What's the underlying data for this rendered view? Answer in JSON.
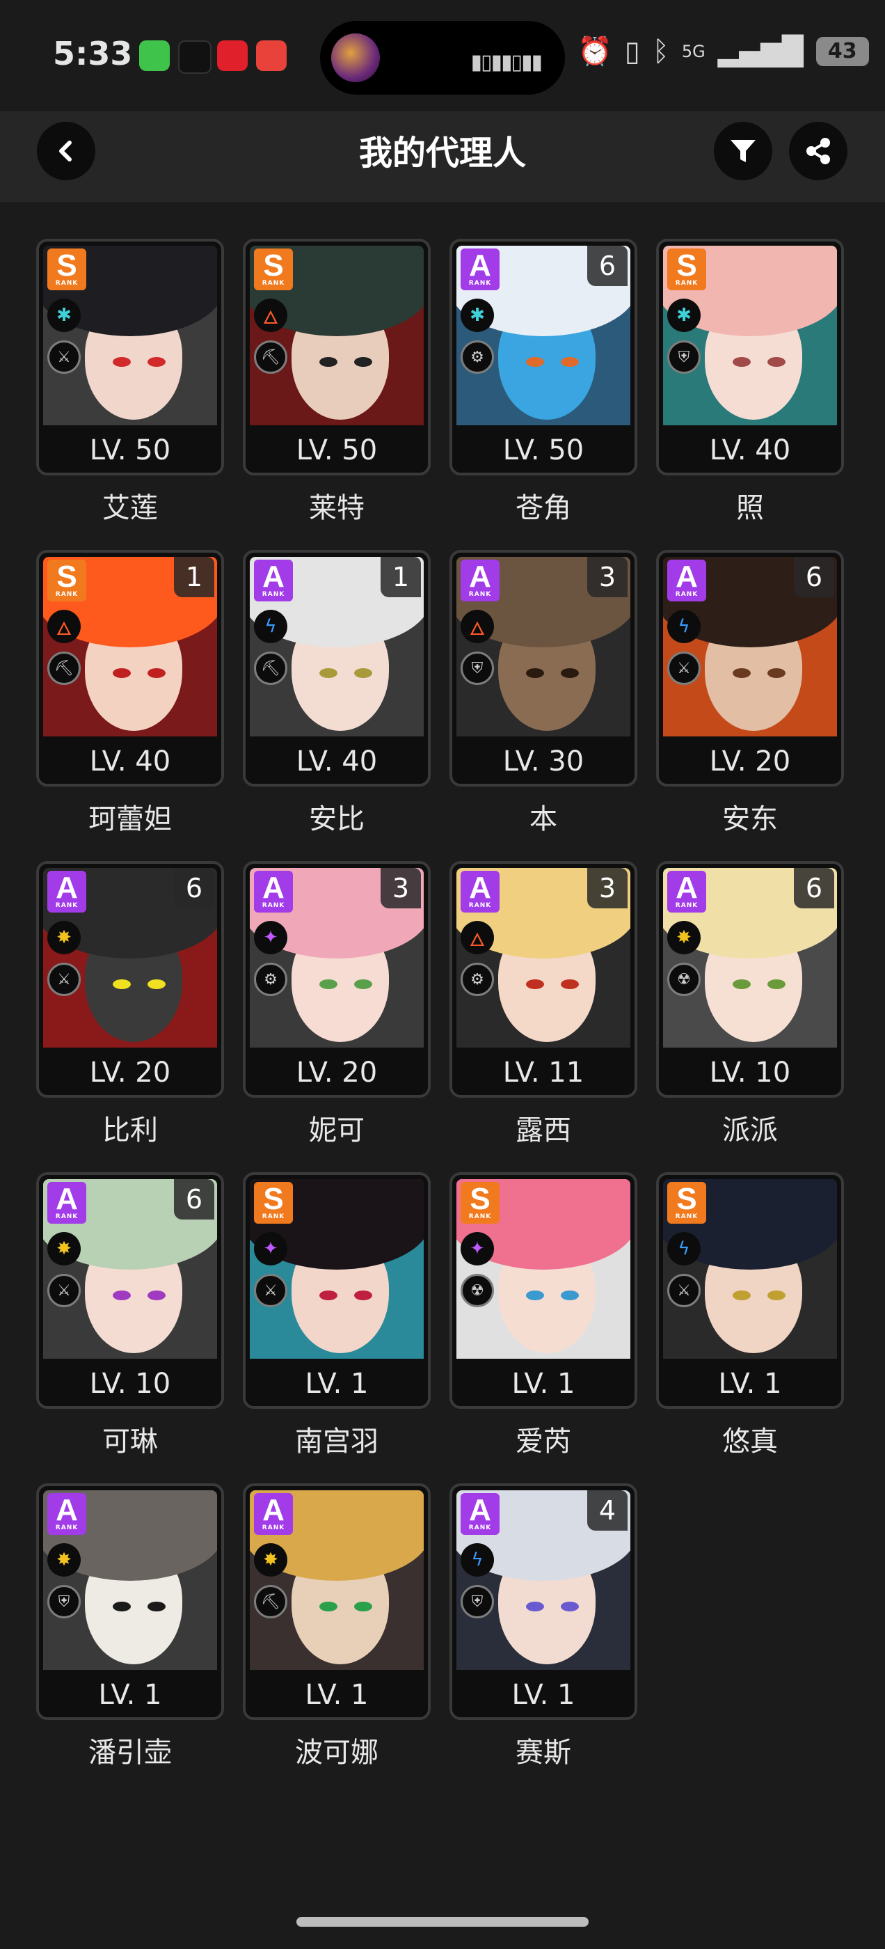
{
  "status_bar": {
    "time": "5:33",
    "network": "5G",
    "battery": "43",
    "notification_icons": [
      "messages-icon",
      "music-icon",
      "heart-app-icon",
      "game-app-icon"
    ],
    "notification_colors": [
      "#3fc34a",
      "#111111",
      "#e0202a",
      "#e8423a"
    ],
    "system_icons": [
      "alarm-icon",
      "vibrate-icon",
      "bluetooth-icon",
      "signal-icon"
    ]
  },
  "header": {
    "title": "我的代理人",
    "back_icon": "chevron-left-icon",
    "filter_icon": "filter-icon",
    "share_icon": "share-icon"
  },
  "colors": {
    "rank_s": "#f27a1e",
    "rank_a": "#a23be8",
    "background": "#1b1b1b",
    "card_border": "#3a3a3a"
  },
  "agents": [
    {
      "name": "艾莲",
      "level": "LV. 50",
      "rank": "S",
      "mindscape": "",
      "attribute": "ice",
      "attr_color": "#3fd0d8",
      "specialty": "attack",
      "hair": "#1e1e22",
      "skin": "#f1d6cc",
      "eye": "#d22a2a",
      "bg": "#3c3c3c"
    },
    {
      "name": "莱特",
      "level": "LV. 50",
      "rank": "S",
      "mindscape": "",
      "attribute": "fire",
      "attr_color": "#ff5a2a",
      "specialty": "stun",
      "hair": "#2a3a34",
      "skin": "#e8cdbd",
      "eye": "#222222",
      "bg": "#6a1818"
    },
    {
      "name": "苍角",
      "level": "LV. 50",
      "rank": "A",
      "mindscape": "6",
      "attribute": "ice",
      "attr_color": "#3fd0d8",
      "specialty": "support",
      "hair": "#e8eef5",
      "skin": "#3aa5e0",
      "eye": "#e06a2a",
      "bg": "#2c5a7a"
    },
    {
      "name": "照",
      "level": "LV. 40",
      "rank": "S",
      "mindscape": "",
      "attribute": "ice",
      "attr_color": "#3fd0d8",
      "specialty": "defense",
      "hair": "#f2b6b0",
      "skin": "#f6ddd4",
      "eye": "#a14a4a",
      "bg": "#2a7a7a"
    },
    {
      "name": "珂蕾妲",
      "level": "LV. 40",
      "rank": "S",
      "mindscape": "1",
      "attribute": "fire",
      "attr_color": "#ff5a2a",
      "specialty": "stun",
      "hair": "#ff5a1e",
      "skin": "#f4d2c2",
      "eye": "#c02020",
      "bg": "#7a1a1a"
    },
    {
      "name": "安比",
      "level": "LV. 40",
      "rank": "A",
      "mindscape": "1",
      "attribute": "electric",
      "attr_color": "#3a9cff",
      "specialty": "stun",
      "hair": "#e4e4e4",
      "skin": "#f3ddd2",
      "eye": "#a89a3a",
      "bg": "#3a3a3a"
    },
    {
      "name": "本",
      "level": "LV. 30",
      "rank": "A",
      "mindscape": "3",
      "attribute": "fire",
      "attr_color": "#ff5a2a",
      "specialty": "defense",
      "hair": "#6b5440",
      "skin": "#8a6c52",
      "eye": "#2a1a10",
      "bg": "#2a2a2a"
    },
    {
      "name": "安东",
      "level": "LV. 20",
      "rank": "A",
      "mindscape": "6",
      "attribute": "electric",
      "attr_color": "#3a9cff",
      "specialty": "attack",
      "hair": "#2e1e18",
      "skin": "#e2bfa4",
      "eye": "#6a3a20",
      "bg": "#c44a1a"
    },
    {
      "name": "比利",
      "level": "LV. 20",
      "rank": "A",
      "mindscape": "6",
      "attribute": "physical",
      "attr_color": "#f2c21e",
      "specialty": "attack",
      "hair": "#2a2a2a",
      "skin": "#3a3a3a",
      "eye": "#f0e020",
      "bg": "#8a1a1a"
    },
    {
      "name": "妮可",
      "level": "LV. 20",
      "rank": "A",
      "mindscape": "3",
      "attribute": "ether",
      "attr_color": "#c05aff",
      "specialty": "support",
      "hair": "#f0a8b8",
      "skin": "#f6dcd2",
      "eye": "#5aa04a",
      "bg": "#3a3a3a"
    },
    {
      "name": "露西",
      "level": "LV. 11",
      "rank": "A",
      "mindscape": "3",
      "attribute": "fire",
      "attr_color": "#ff5a2a",
      "specialty": "support",
      "hair": "#f0d080",
      "skin": "#f4d8c8",
      "eye": "#c03020",
      "bg": "#2a2a2a"
    },
    {
      "name": "派派",
      "level": "LV. 10",
      "rank": "A",
      "mindscape": "6",
      "attribute": "physical",
      "attr_color": "#f2c21e",
      "specialty": "anomaly",
      "hair": "#f0e0a8",
      "skin": "#f6e0d4",
      "eye": "#6a9a3a",
      "bg": "#4a4a4a"
    },
    {
      "name": "可琳",
      "level": "LV. 10",
      "rank": "A",
      "mindscape": "6",
      "attribute": "physical",
      "attr_color": "#f2c21e",
      "specialty": "attack",
      "hair": "#b8d0b4",
      "skin": "#f4dcd2",
      "eye": "#a03ac0",
      "bg": "#3a3a3a"
    },
    {
      "name": "南宫羽",
      "level": "LV. 1",
      "rank": "S",
      "mindscape": "",
      "attribute": "ether",
      "attr_color": "#c05aff",
      "specialty": "attack",
      "hair": "#1a1418",
      "skin": "#f2d6ca",
      "eye": "#c02040",
      "bg": "#2a8a9a"
    },
    {
      "name": "爱芮",
      "level": "LV. 1",
      "rank": "S",
      "mindscape": "",
      "attribute": "ether",
      "attr_color": "#c05aff",
      "specialty": "anomaly",
      "hair": "#f07090",
      "skin": "#f6ddd2",
      "eye": "#3a9ad0",
      "bg": "#e0e0e0"
    },
    {
      "name": "悠真",
      "level": "LV. 1",
      "rank": "S",
      "mindscape": "",
      "attribute": "electric",
      "attr_color": "#3a9cff",
      "specialty": "attack",
      "hair": "#1a2030",
      "skin": "#f0d4c4",
      "eye": "#c0a030",
      "bg": "#2a2a2a"
    },
    {
      "name": "潘引壶",
      "level": "LV. 1",
      "rank": "A",
      "mindscape": "",
      "attribute": "physical",
      "attr_color": "#f2c21e",
      "specialty": "defense",
      "hair": "#6a6460",
      "skin": "#eeeae4",
      "eye": "#1a1a1a",
      "bg": "#3a3a3a"
    },
    {
      "name": "波可娜",
      "level": "LV. 1",
      "rank": "A",
      "mindscape": "",
      "attribute": "physical",
      "attr_color": "#f2c21e",
      "specialty": "stun",
      "hair": "#d8a84a",
      "skin": "#e8d0b8",
      "eye": "#2aa04a",
      "bg": "#3a3030"
    },
    {
      "name": "赛斯",
      "level": "LV. 1",
      "rank": "A",
      "mindscape": "4",
      "attribute": "electric",
      "attr_color": "#3a9cff",
      "specialty": "defense",
      "hair": "#d8dce4",
      "skin": "#f2dcd2",
      "eye": "#6a5ad0",
      "bg": "#2a2e3a"
    }
  ]
}
